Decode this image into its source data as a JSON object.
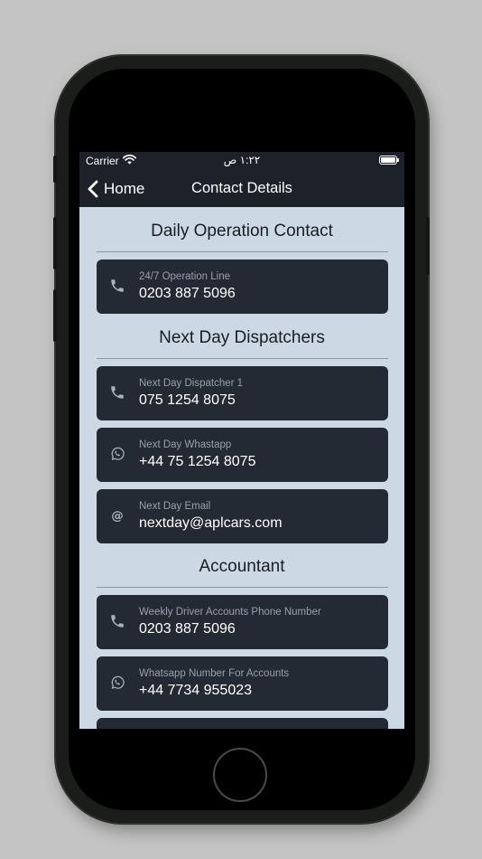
{
  "status_bar": {
    "carrier": "Carrier",
    "time": "١:٢٢ ص"
  },
  "nav": {
    "back_label": "Home",
    "title": "Contact Details"
  },
  "sections": [
    {
      "title": "Daily Operation Contact",
      "items": [
        {
          "icon": "phone-icon",
          "label": "24/7 Operation Line",
          "value": "0203 887 5096"
        }
      ]
    },
    {
      "title": "Next Day Dispatchers",
      "items": [
        {
          "icon": "phone-icon",
          "label": "Next Day Dispatcher 1",
          "value": "075 1254 8075"
        },
        {
          "icon": "whatsapp-icon",
          "label": "Next Day Whastapp",
          "value": "+44 75 1254 8075"
        },
        {
          "icon": "at-email-icon",
          "label": "Next Day Email",
          "value": "nextday@aplcars.com"
        }
      ]
    },
    {
      "title": "Accountant",
      "items": [
        {
          "icon": "phone-icon",
          "label": "Weekly Driver Accounts Phone Number",
          "value": "0203 887 5096"
        },
        {
          "icon": "whatsapp-icon",
          "label": "Whatsapp Number For Accounts",
          "value": "+44 7734 955023"
        }
      ]
    }
  ],
  "colors": {
    "background": "#ccd8e4",
    "bar": "#1c212a",
    "card": "#242a33",
    "label": "#97a0ab"
  }
}
